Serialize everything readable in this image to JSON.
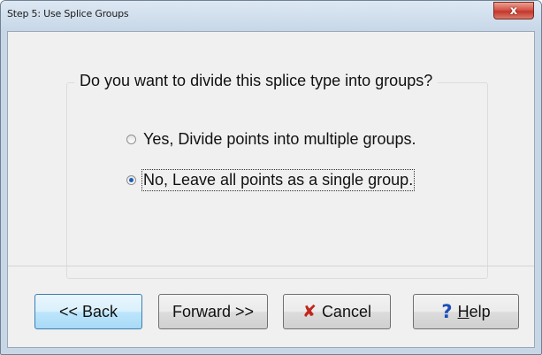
{
  "window": {
    "title": "Step 5: Use Splice Groups",
    "close_glyph": "x"
  },
  "group": {
    "question": "Do you want to divide this splice type into groups?",
    "options": [
      {
        "label": "Yes, Divide points into multiple groups.",
        "selected": false
      },
      {
        "label": "No, Leave all points as a single group.",
        "selected": true
      }
    ]
  },
  "buttons": {
    "back": "<< Back",
    "forward": "Forward >>",
    "cancel": "Cancel",
    "help_prefix": "",
    "help_mnemonic": "H",
    "help_rest": "elp"
  },
  "icons": {
    "cancel": "x-icon",
    "help": "question-icon",
    "cancel_glyph": "✘",
    "help_glyph": "?"
  }
}
